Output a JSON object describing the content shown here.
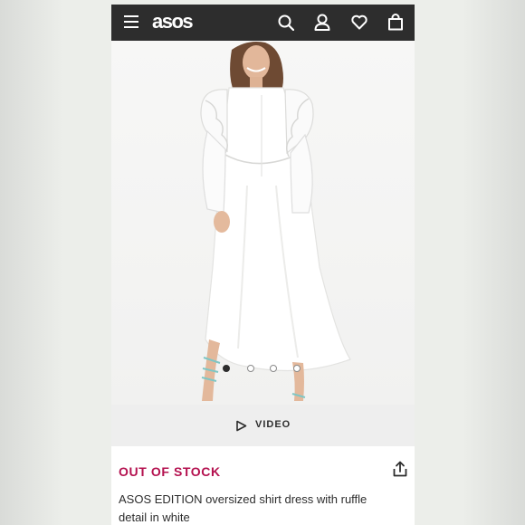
{
  "header": {
    "logo": "asos",
    "icons": [
      "menu-icon",
      "search-icon",
      "account-icon",
      "heart-icon",
      "bag-icon"
    ]
  },
  "gallery": {
    "image_count": 4,
    "active_index": 0,
    "video_label": "VIDEO"
  },
  "product": {
    "stock_status": "OUT OF STOCK",
    "title": "ASOS EDITION oversized shirt dress with ruffle detail in white"
  },
  "colors": {
    "header_bg": "#2d2d2d",
    "stock_status": "#b4114f",
    "text": "#2d2d2d"
  }
}
